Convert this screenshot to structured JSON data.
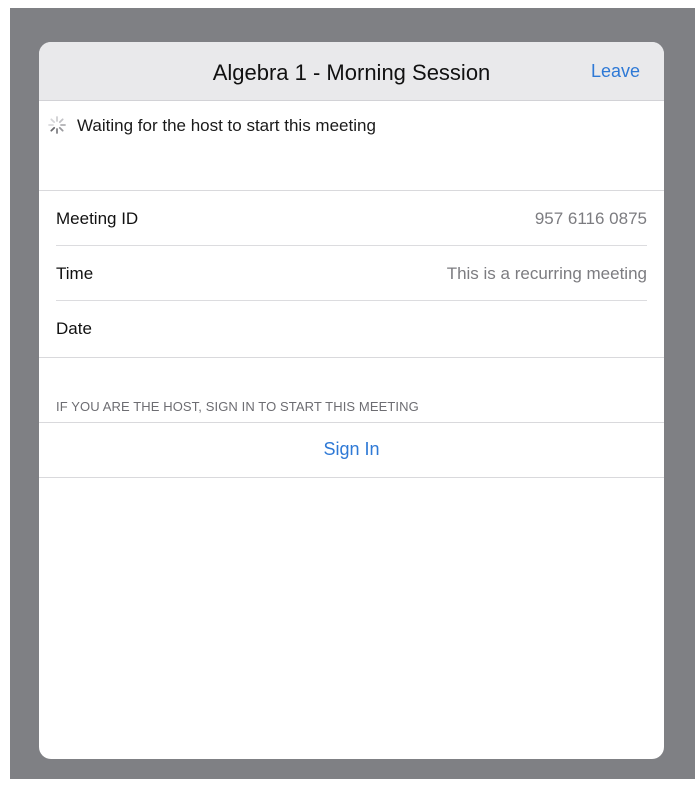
{
  "dialog": {
    "title": "Algebra 1 - Morning Session",
    "leave_label": "Leave"
  },
  "status": {
    "text": "Waiting for the host to start this meeting",
    "icon": "loading-spinner-icon"
  },
  "details": [
    {
      "label": "Meeting ID",
      "value": "957 6116 0875"
    },
    {
      "label": "Time",
      "value": "This is a recurring meeting"
    },
    {
      "label": "Date",
      "value": ""
    }
  ],
  "host_section": {
    "header": "IF YOU ARE THE HOST, SIGN IN TO START THIS MEETING",
    "sign_in_label": "Sign In"
  },
  "colors": {
    "accent": "#2e79d6",
    "backdrop": "#7f8084",
    "header_bg": "#e9e9eb"
  }
}
